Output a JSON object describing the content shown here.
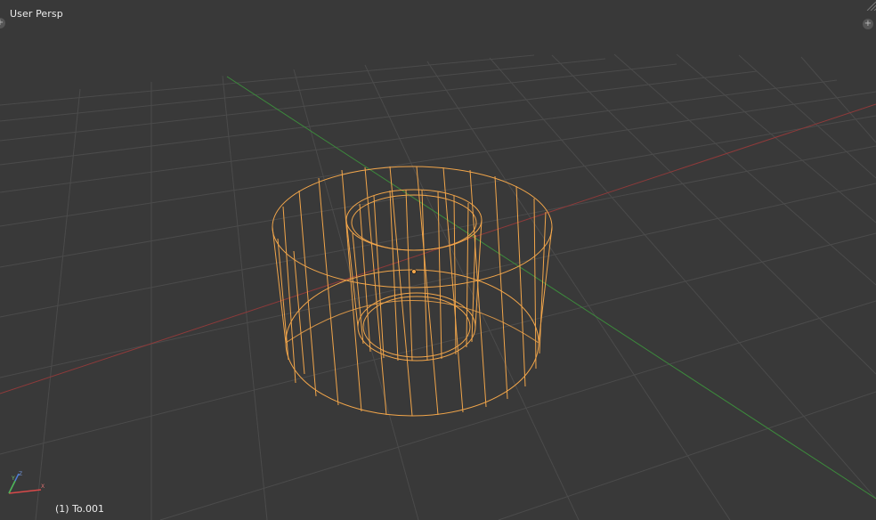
{
  "viewport": {
    "view_name": "User Persp",
    "object_info": "(1) To.001"
  },
  "gizmo": {
    "axis_z_label": "Z",
    "axis_y_label": "Y",
    "axis_x_label": "X"
  },
  "colors": {
    "background": "#393939",
    "grid_line": "#4a4a4a",
    "x_axis": "#a33c3c",
    "y_axis": "#3f8f3f",
    "selected_wire": "#f1a54a",
    "text": "#ececec"
  },
  "icons": {
    "left_corner": "plus-icon",
    "right_corner": "plus-icon",
    "top_right_hatch": "region-split-icon"
  }
}
